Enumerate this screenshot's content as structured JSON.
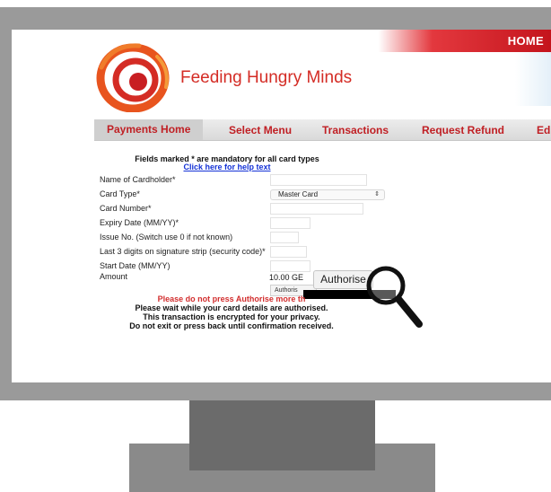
{
  "site": {
    "name": "Feeding Hungry Minds",
    "home_link": "HOME"
  },
  "nav": {
    "tabs": [
      "Payments Home",
      "Select Menu",
      "Transactions",
      "Request Refund",
      "Edi"
    ]
  },
  "form": {
    "mandatory_note": "Fields marked * are mandatory for all card types",
    "help_link": "Click here for help text",
    "fields": {
      "cardholder": {
        "label": "Name of Cardholder*",
        "value": ""
      },
      "card_type": {
        "label": "Card Type*",
        "value": "Master Card"
      },
      "card_number": {
        "label": "Card Number*",
        "value": ""
      },
      "expiry": {
        "label": "Expiry Date (MM/YY)*",
        "value": ""
      },
      "issue_no": {
        "label": "Issue No. (Switch use 0 if not known)",
        "value": ""
      },
      "security_code": {
        "label": "Last 3 digits on signature strip (security code)*",
        "value": ""
      },
      "start_date": {
        "label": "Start Date (MM/YY)",
        "value": ""
      },
      "amount": {
        "label": "Amount",
        "value": "10.00 GE"
      }
    },
    "authorise_button": "Authorise",
    "authorise_small": "Authoris"
  },
  "messages": {
    "warning": "Please do not press Authorise more th",
    "line1": "Please wait while your card details are authorised.",
    "line2": "This transaction is encrypted for your privacy.",
    "line3": "Do not exit or press back until confirmation received."
  },
  "colors": {
    "brand_red": "#c01f24",
    "link_blue": "#1432d6",
    "warning_red": "#d22e2e",
    "monitor_gray": "#9a9a9a"
  },
  "icons": {
    "logo": "spiral-logo-icon",
    "select_arrow": "updown-arrow-icon",
    "magnifier": "magnifying-glass-icon"
  }
}
